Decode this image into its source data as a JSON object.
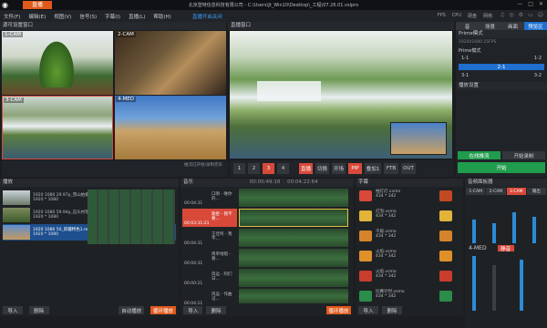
{
  "app": {
    "tab_label": "直播",
    "window_title": "北京登特信息科技有限公司 - C:\\Users\\Jt_Win10\\Desktop\\_工程\\07.26.01.vslpro"
  },
  "menu": {
    "items": [
      "文件(F)",
      "编辑(E)",
      "视图(V)",
      "信号(S)",
      "字幕(I)",
      "直播(L)",
      "帮助(H)"
    ],
    "promo": "直播开启关闭"
  },
  "status": {
    "fps": "FPS",
    "cpu": "CPU",
    "disk": "硬盘",
    "net": "网络"
  },
  "sources_panel": {
    "title": "源可设置窗口",
    "cams": [
      "1-CAM",
      "2-CAM",
      "3-CAM",
      "4-MED"
    ]
  },
  "program_panel": {
    "title": "直播窗口"
  },
  "right_panel": {
    "tabs": [
      "音",
      "场景",
      "画面",
      "预览区"
    ],
    "prime_label": "Prime模式",
    "output_row": "1920X1080 25FPS",
    "layout_label": "Prime模式",
    "layout_values": [
      "1-1",
      "1-2",
      "2-1",
      "3-1",
      "3-2"
    ],
    "transition_label": "播放设置",
    "btn_live": "在线推流",
    "btn_record": "开始录制",
    "btn_start": "开始"
  },
  "program_controls": {
    "left_hint": "推流已开始/录制完毕",
    "buttons": [
      "1",
      "2",
      "3",
      "4"
    ],
    "take": "直播",
    "cut": "切换",
    "auto": "开场",
    "pip": "PIP",
    "overlay": "叠加1",
    "ftb": "FTB",
    "out": "OUT"
  },
  "media_panel": {
    "title": "播放",
    "items": [
      {
        "name": "1920 1080 29.97p_雪山拍摄.mp4",
        "meta": "1920 * 1080",
        "dur": "00:03:06:17"
      },
      {
        "name": "1920 1080 59.94p_石头村落.mp4",
        "meta": "1920 * 1080",
        "dur": "00:01:22:07"
      },
      {
        "name": "1920 1080 50_新疆特色1.mp4",
        "meta": "1920 * 1080",
        "dur": "00:00:12:00"
      }
    ],
    "btn_import": "导入",
    "btn_delete": "删除",
    "btn_loop": "循环播放",
    "btn_auto": "自动播放"
  },
  "audio_list": {
    "title": "音乐",
    "time_total": "00:00:49:18",
    "time_cur": "00:04:22:64",
    "items": [
      {
        "name": "口哨 - 唯你的...",
        "dur": "00:04:31"
      },
      {
        "name": "歌星 - 我不要...",
        "dur": "00:03:31:21"
      },
      {
        "name": "王佳鸣 - 我不...",
        "dur": "00:04:31"
      },
      {
        "name": "简单地唱 - 春...",
        "dur": "00:04:31"
      },
      {
        "name": "风运 - 阿们日...",
        "dur": "00:00:21"
      },
      {
        "name": "风运 - 作曲记...",
        "dur": "00:04:21"
      }
    ],
    "btn_import": "导入",
    "btn_delete": "删除",
    "btn_loop": "循环播放"
  },
  "effects_panel": {
    "title": "字幕",
    "items": [
      {
        "name": "拍灯灯.vsmo",
        "size": "434 * 342"
      },
      {
        "name": "灯泡.vsmo",
        "size": "434 * 342"
      },
      {
        "name": "千般.vsmo",
        "size": "434 * 342"
      },
      {
        "name": "火焰.vsmo",
        "size": "434 * 342"
      },
      {
        "name": "火焰.vsmo",
        "size": "434 * 342"
      },
      {
        "name": "比赛计时.vsmo",
        "size": "434 * 342"
      }
    ],
    "btn_import": "导入",
    "btn_delete": "删除"
  },
  "mixer": {
    "title": "音频面板器",
    "channels": [
      "1-CAM",
      "2-CAM",
      "3-CAM",
      "输出"
    ],
    "levels": [
      0.55,
      0.45,
      0.7,
      0.6
    ],
    "row2": [
      "4-MED",
      "输入"
    ],
    "mute_label": "静音",
    "solo_label": "监听"
  },
  "colors": {
    "accent": "#e05a1c",
    "red": "#d8493a",
    "green": "#1f9c4c",
    "blue": "#1e6fd0"
  }
}
